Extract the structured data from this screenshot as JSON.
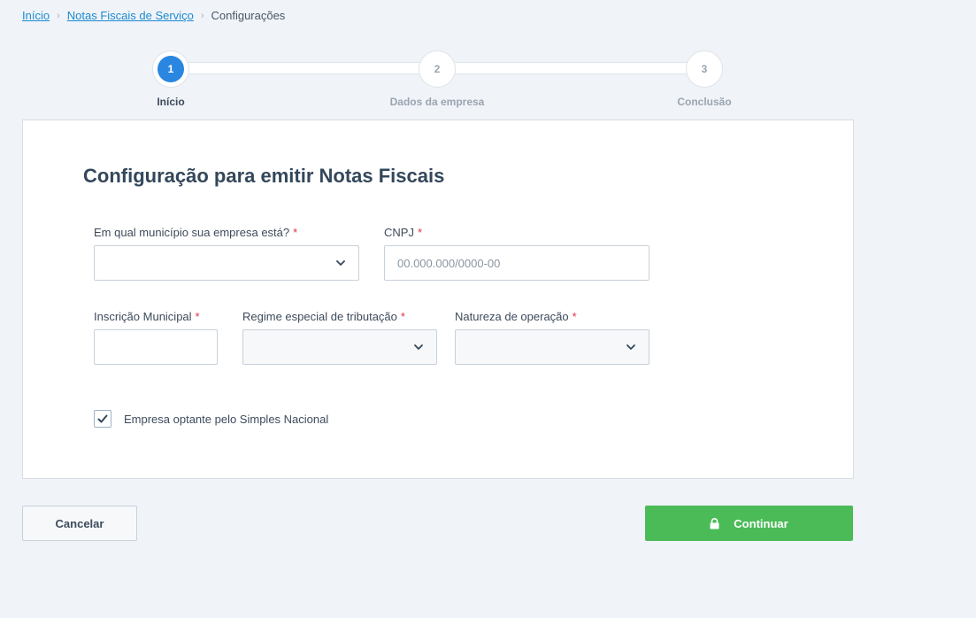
{
  "breadcrumb": {
    "items": [
      "Início",
      "Notas Fiscais de Serviço"
    ],
    "current": "Configurações"
  },
  "stepper": {
    "steps": [
      {
        "number": "1",
        "label": "Início",
        "active": true
      },
      {
        "number": "2",
        "label": "Dados da empresa",
        "active": false
      },
      {
        "number": "3",
        "label": "Conclusão",
        "active": false
      }
    ]
  },
  "form": {
    "title": "Configuração para emitir Notas Fiscais",
    "municipio": {
      "label": "Em qual município sua empresa está?",
      "value": ""
    },
    "cnpj": {
      "label": "CNPJ",
      "placeholder": "00.000.000/0000-00",
      "value": ""
    },
    "inscricao": {
      "label": "Inscrição Municipal",
      "value": ""
    },
    "regime": {
      "label": "Regime especial de tributação",
      "value": ""
    },
    "natureza": {
      "label": "Natureza de operação",
      "value": ""
    },
    "required_mark": "*",
    "simples": {
      "label": "Empresa optante pelo Simples Nacional",
      "checked": true
    }
  },
  "actions": {
    "cancel_label": "Cancelar",
    "continue_label": "Continuar"
  },
  "icons": {
    "breadcrumb_separator": "chevron-right-icon",
    "select_chevron": "chevron-down-icon",
    "checkbox": "check-icon",
    "continue": "lock-icon"
  },
  "colors": {
    "background": "#f0f3f8",
    "link": "#1a8bd0",
    "step_active": "#2a86e0",
    "required": "#e0334c",
    "primary_button": "#4bbb58",
    "title": "#33475b"
  }
}
